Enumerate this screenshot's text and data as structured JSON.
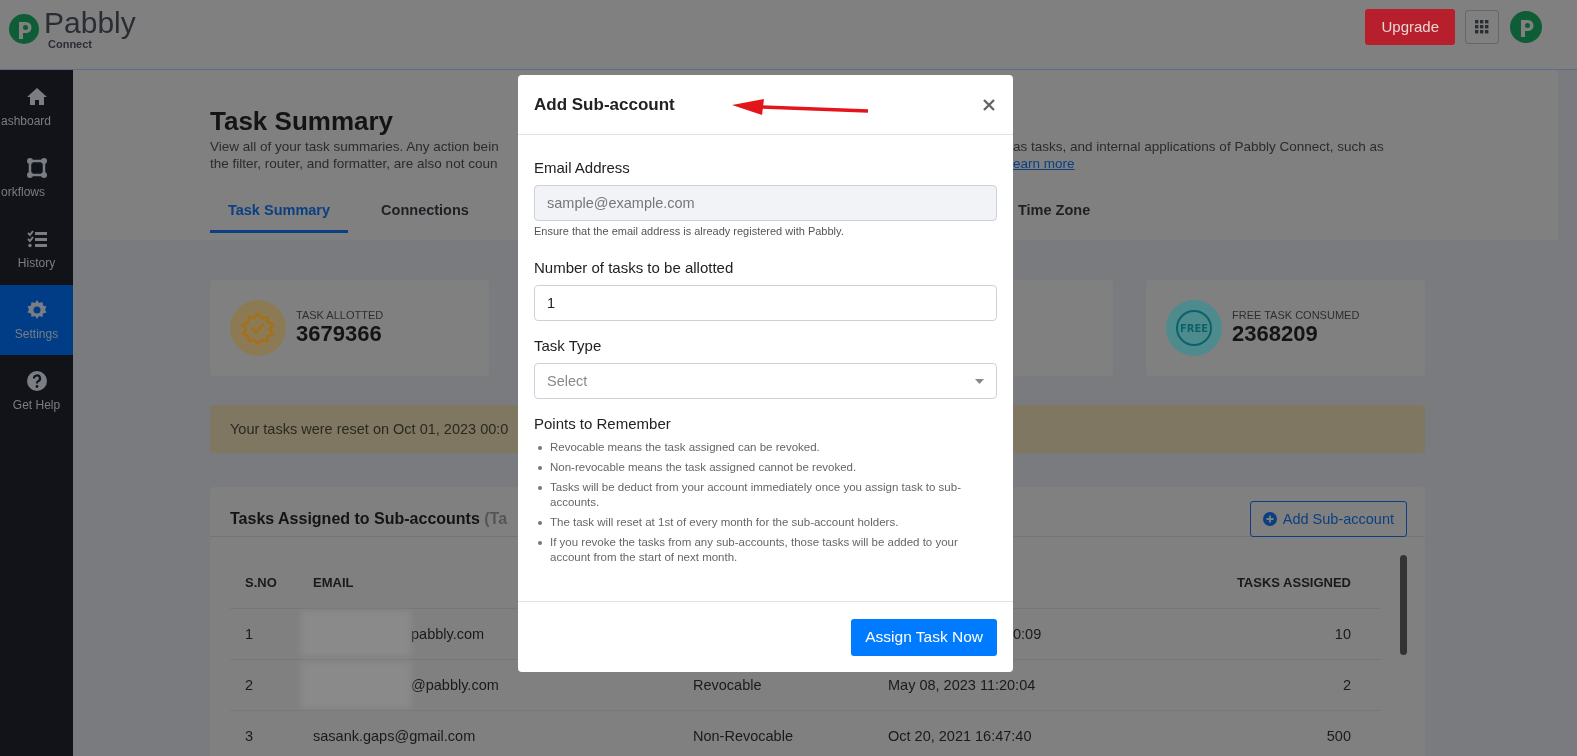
{
  "header": {
    "logo": {
      "name": "Pabbly",
      "sub": "Connect"
    },
    "upgrade_button": "Upgrade"
  },
  "sidebar": {
    "items": [
      {
        "label": "ashboard",
        "selected": false
      },
      {
        "label": "orkflows",
        "selected": false
      },
      {
        "label": "History",
        "selected": false
      },
      {
        "label": "Settings",
        "selected": true
      },
      {
        "label": "Get Help",
        "selected": false
      }
    ]
  },
  "page": {
    "title": "Task Summary",
    "description": [
      {
        "left": "View all of your task summaries. Any action bein",
        "right": "as tasks, and internal applications of Pabbly Connect, such as"
      },
      {
        "left": "the filter, router, and formatter, are also not coun",
        "link": "earn more"
      }
    ],
    "tabs": [
      {
        "label": "Task Summary",
        "selected": true
      },
      {
        "label": "Connections",
        "selected": false
      },
      {
        "label": "Time Zone",
        "selected": false
      }
    ],
    "stats": [
      {
        "kind": "allotted",
        "label": "TASK ALLOTTED",
        "value": "3679366"
      },
      {
        "kind": "hidden"
      },
      {
        "kind": "free",
        "icon_text": "FREE",
        "label": "FREE TASK CONSUMED",
        "value": "2368209"
      }
    ],
    "banner": "Your tasks were reset on Oct 01, 2023 00:0",
    "table": {
      "title": "Tasks Assigned to Sub-accounts",
      "title_note": "(Ta",
      "add_button": "Add Sub-account",
      "columns": {
        "s_no": "S.NO",
        "email": "EMAIL",
        "tasks_assigned": "TASKS ASSIGNED"
      },
      "rows": [
        {
          "s_no": "1",
          "email": "pabbly.com",
          "redacted": true,
          "date": "0:09",
          "date_partial": true,
          "tasks": "10"
        },
        {
          "s_no": "2",
          "email": "@pabbly.com",
          "redacted": true,
          "type": "Revocable",
          "date": "May 08, 2023 11:20:04",
          "date_partial": false,
          "tasks": "2"
        },
        {
          "s_no": "3",
          "email": "sasank.gaps@gmail.com",
          "redacted": false,
          "type": "Non-Revocable",
          "date": "Oct 20, 2021 16:47:40",
          "date_partial": false,
          "tasks": "500"
        }
      ]
    }
  },
  "modal": {
    "title": "Add Sub-account",
    "fields": [
      {
        "kind": "text",
        "label": "Email Address",
        "placeholder": "sample@example.com",
        "disabled": true,
        "help": "Ensure that the email address is already registered with Pabbly."
      },
      {
        "kind": "text",
        "label": "Number of tasks to be allotted",
        "value": "1",
        "disabled": false
      },
      {
        "kind": "select",
        "label": "Task Type",
        "placeholder": "Select"
      }
    ],
    "points_title": "Points to Remember",
    "points": [
      "Revocable means the task assigned can be revoked.",
      "Non-revocable means the task assigned cannot be revoked.",
      "Tasks will be deduct from your account immediately once you assign task to sub-accounts.",
      "The task will reset at 1st of every month for the sub-account holders.",
      "If you revoke the tasks from any sub-accounts, those tasks will be added to your account from the start of next month."
    ],
    "submit_button": "Assign Task Now"
  }
}
